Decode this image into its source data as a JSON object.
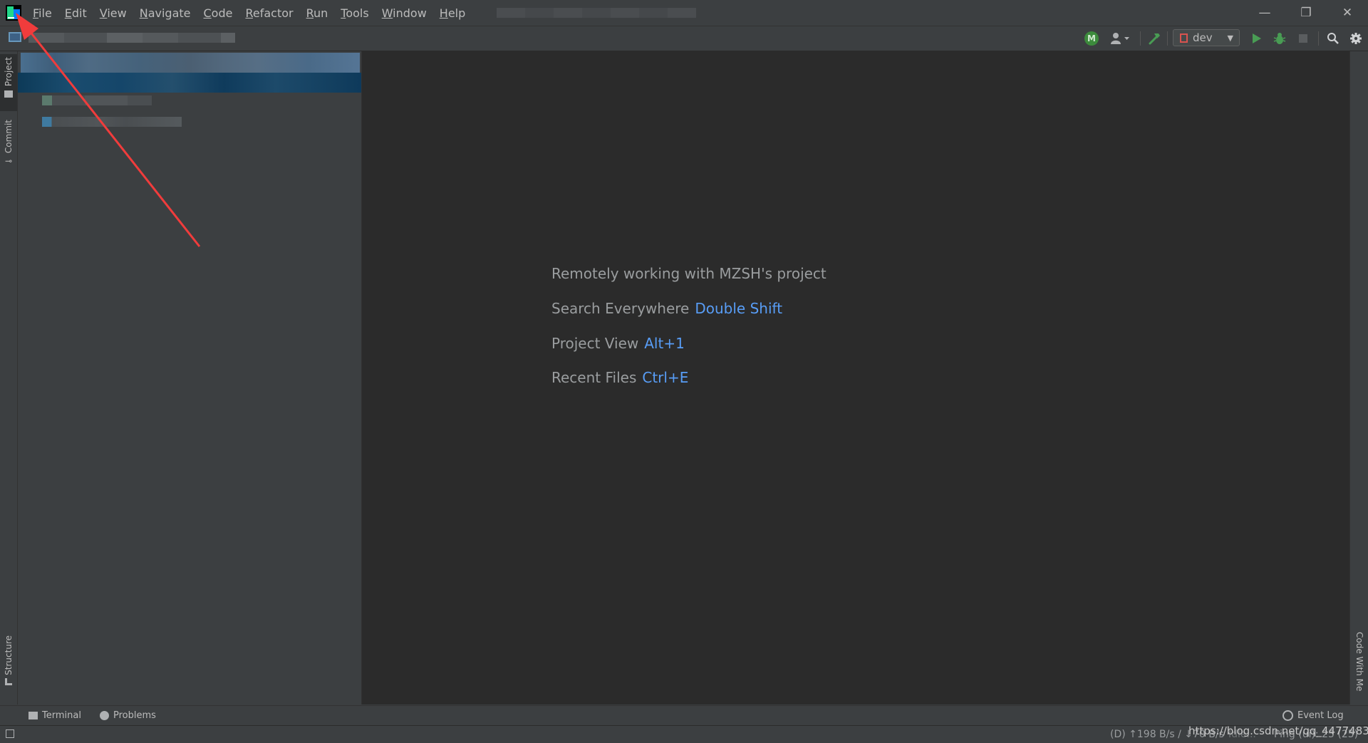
{
  "menu": {
    "items": [
      "File",
      "Edit",
      "View",
      "Navigate",
      "Code",
      "Refactor",
      "Run",
      "Tools",
      "Window",
      "Help"
    ]
  },
  "window_controls": {
    "minimize": "—",
    "restore": "❐",
    "close": "✕"
  },
  "toolbar": {
    "vcs_badge": "M",
    "branch": "dev"
  },
  "left_stripe": {
    "project_tab": "Project",
    "commit_tab": "Commit",
    "structure_tab": "Structure"
  },
  "right_stripe": {
    "code_with_me_tab": "Code With Me"
  },
  "editor": {
    "remote_notice": "Remotely working with MZSH's project",
    "hints": [
      {
        "label": "Search Everywhere",
        "key": "Double Shift"
      },
      {
        "label": "Project View",
        "key": "Alt+1"
      },
      {
        "label": "Recent Files",
        "key": "Ctrl+E"
      }
    ]
  },
  "bottom_tabs": {
    "terminal": "Terminal",
    "problems": "Problems",
    "event_log": "Event Log"
  },
  "status": {
    "traffic": "(D) ↑198 B/s / ↓70 B/s",
    "idle": "Idle...",
    "ping": "Ping (ui): 25 (25)",
    "watermark": "https://blog.csdn.net/qq_44774831"
  },
  "colors": {
    "editor_bg": "#2b2b2b",
    "panel_bg": "#3c3f41",
    "shortcut_blue": "#589df6",
    "annotation_red": "#f03c3c"
  },
  "icons": {
    "app_logo": "app-logo-icon",
    "run": "run-icon",
    "debug": "debug-icon",
    "stop": "stop-icon",
    "search": "search-icon",
    "settings": "gear-icon",
    "build": "hammer-icon",
    "user": "user-icon"
  }
}
